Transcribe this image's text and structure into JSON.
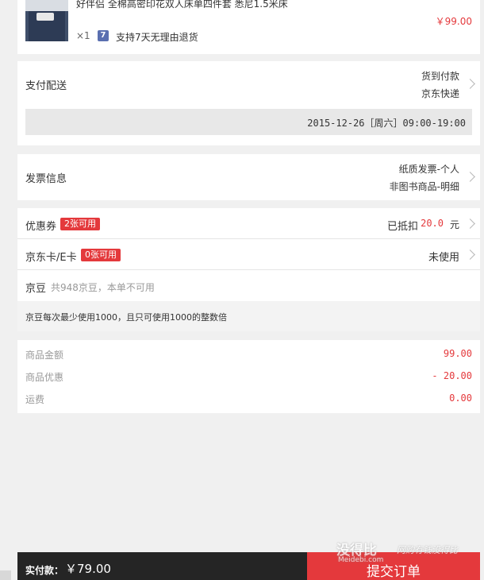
{
  "product": {
    "title": "好伴侣 全棉高密印花双人床单四件套 悉尼1.5米床",
    "price": "￥99.00",
    "quantity": "×1",
    "return_badge": "7",
    "return_text": "支持7天无理由退货",
    "image_icon": "bedding-product-image"
  },
  "delivery": {
    "label": "支付配送",
    "payment": "货到付款",
    "carrier": "京东快递",
    "time": "2015-12-26［周六］09:00-19:00"
  },
  "invoice": {
    "label": "发票信息",
    "type": "纸质发票-个人",
    "content": "非图书商品-明细"
  },
  "coupon": {
    "label": "优惠券",
    "badge": "2张可用",
    "status_prefix": "已抵扣",
    "amount": "20.0",
    "unit": "元"
  },
  "jdcard": {
    "label": "京东卡/E卡",
    "badge": "0张可用",
    "status": "未使用"
  },
  "jdbean": {
    "label": "京豆",
    "info": "共948京豆，本单不可用",
    "rule": "京豆每次最少使用1000，且只可使用1000的整数倍"
  },
  "summary": {
    "items": [
      {
        "label": "商品金额",
        "value": "99.00"
      },
      {
        "label": "商品优惠",
        "value": "- 20.00"
      },
      {
        "label": "运费",
        "value": "0.00"
      }
    ]
  },
  "footer": {
    "total_label": "实付款：",
    "total_value": "￥79.00",
    "submit_label": "提交订单"
  },
  "watermark": {
    "brand": "没得比",
    "domain": "Meidebi.com",
    "slogan": "网购有钱没得比"
  },
  "colors": {
    "accent": "#e4393c",
    "footer_bg": "#252525",
    "submit_bg": "#e4393c"
  }
}
